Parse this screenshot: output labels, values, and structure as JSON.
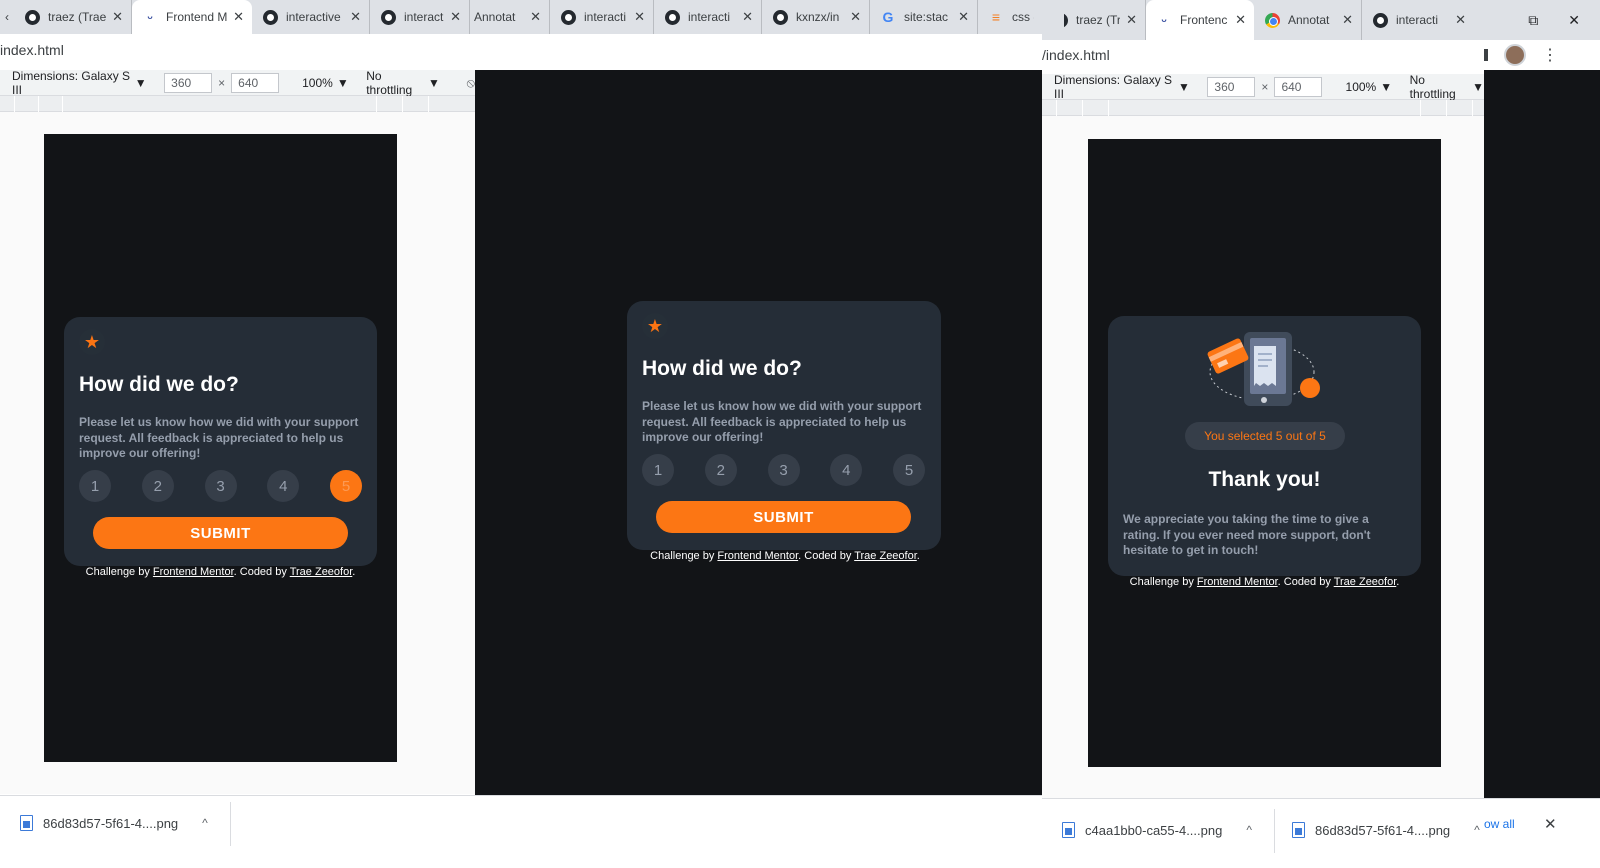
{
  "left_window": {
    "tabs": [
      {
        "icon": "github-icon",
        "title": "traez (Trae",
        "close": "✕"
      },
      {
        "icon": "frontend-mentor-icon",
        "title": "Frontend M",
        "close": "✕"
      },
      {
        "icon": "github-icon",
        "title": "interactive",
        "close": "✕"
      },
      {
        "icon": "github-icon",
        "title": "interactive",
        "close": "✕"
      },
      {
        "icon": "annotation-icon",
        "title": "Annotat",
        "close": "✕"
      },
      {
        "icon": "github-icon",
        "title": "interacti",
        "close": "✕"
      },
      {
        "icon": "github-icon",
        "title": "interacti",
        "close": "✕"
      },
      {
        "icon": "github-icon",
        "title": "kxnzx/in",
        "close": "✕"
      },
      {
        "icon": "google-icon",
        "title": "site:stac",
        "close": "✕"
      },
      {
        "icon": "stackoverflow-icon",
        "title": "css -",
        "close": ""
      }
    ],
    "url": "index.html",
    "devtools": {
      "dimensions_label": "Dimensions: Galaxy S III",
      "width": "360",
      "height": "640",
      "times": "×",
      "zoom": "100%",
      "throttling": "No throttling"
    }
  },
  "rating_card": {
    "star": "★",
    "title": "How did we do?",
    "description": "Please let us know how we did with your support request. All feedback is appreciated to help us improve our offering!",
    "ratings": [
      "1",
      "2",
      "3",
      "4",
      "5"
    ],
    "selected_rating_left": "5",
    "submit_label": "SUBMIT"
  },
  "attribution": {
    "prefix": "Challenge by ",
    "link1": "Frontend Mentor",
    "middle": ". Coded by ",
    "link2": "Trae Zeeofor",
    "suffix": "."
  },
  "right_window": {
    "tabs": [
      {
        "icon": "github-icon",
        "title": "traez (Tr",
        "close": "✕"
      },
      {
        "icon": "frontend-mentor-icon",
        "title": "Frontenc",
        "close": "✕"
      },
      {
        "icon": "chrome-icon",
        "title": "Annotat",
        "close": "✕"
      },
      {
        "icon": "github-icon",
        "title": "interacti",
        "close": "✕"
      }
    ],
    "url": "/index.html",
    "controls": {
      "restore": "⧉",
      "close": "✕",
      "menu": "⋮"
    },
    "devtools": {
      "dimensions_label": "Dimensions: Galaxy S III",
      "width": "360",
      "height": "640",
      "times": "×",
      "zoom": "100%",
      "throttling": "No throttling"
    }
  },
  "thank_you_card": {
    "selected_text": "You selected 5 out of 5",
    "title": "Thank you!",
    "description": "We appreciate you taking the time to give a rating. If you ever need more support, don't hesitate to get in touch!"
  },
  "downloads": {
    "left_file": "86d83d57-5f61-4....png",
    "right_file_1": "c4aa1bb0-ca55-4....png",
    "right_file_2": "86d83d57-5f61-4....png",
    "show_all": "ow all",
    "chevron": "^",
    "close": "✕"
  },
  "colors": {
    "accent": "#fc7614",
    "card_bg": "#252d37",
    "page_bg": "#121417",
    "muted_text": "#959eac"
  }
}
